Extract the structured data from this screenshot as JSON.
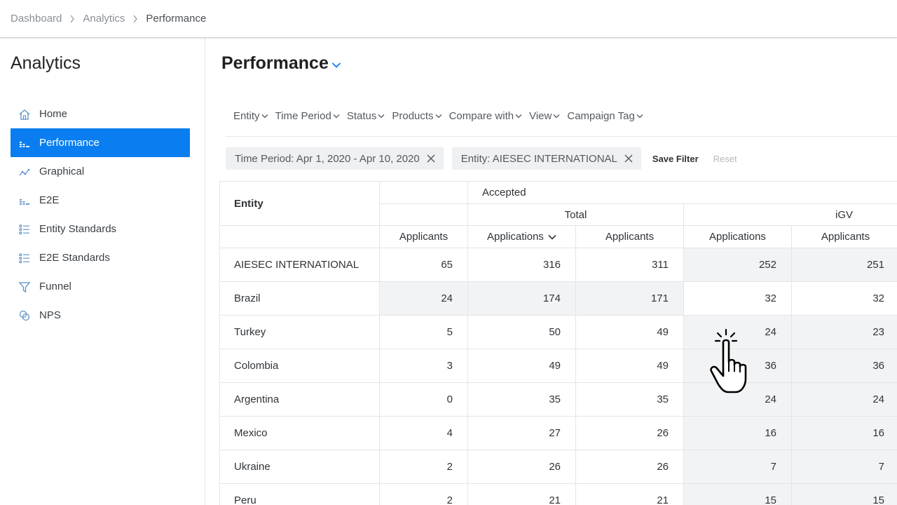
{
  "breadcrumb": [
    "Dashboard",
    "Analytics",
    "Performance"
  ],
  "sidebar": {
    "title": "Analytics",
    "items": [
      {
        "label": "Home",
        "icon": "home-icon",
        "active": false
      },
      {
        "label": "Performance",
        "icon": "bars-icon",
        "active": true
      },
      {
        "label": "Graphical",
        "icon": "line-chart-icon",
        "active": false
      },
      {
        "label": "E2E",
        "icon": "bars-icon",
        "active": false
      },
      {
        "label": "Entity Standards",
        "icon": "list-icon",
        "active": false
      },
      {
        "label": "E2E Standards",
        "icon": "list-icon",
        "active": false
      },
      {
        "label": "Funnel",
        "icon": "funnel-icon",
        "active": false
      },
      {
        "label": "NPS",
        "icon": "nps-icon",
        "active": false
      }
    ]
  },
  "main": {
    "title": "Performance",
    "filters": [
      "Entity",
      "Time Period",
      "Status",
      "Products",
      "Compare with",
      "View",
      "Campaign Tag"
    ],
    "chips": [
      "Time Period: Apr 1, 2020 - Apr 10, 2020",
      "Entity: AIESEC INTERNATIONAL"
    ],
    "save_filter": "Save Filter",
    "reset": "Reset"
  },
  "table": {
    "entity_header": "Entity",
    "group_header": "Accepted",
    "subgroups": [
      "Total",
      "iGV"
    ],
    "columns": [
      "Applicants",
      "Applications",
      "Applicants",
      "Applications",
      "Applicants"
    ],
    "rows": [
      {
        "entity": "AIESEC INTERNATIONAL",
        "values": [
          "65",
          "316",
          "311",
          "252",
          "251"
        ]
      },
      {
        "entity": "Brazil",
        "values": [
          "24",
          "174",
          "171",
          "32",
          "32"
        ]
      },
      {
        "entity": "Turkey",
        "values": [
          "5",
          "50",
          "49",
          "24",
          "23"
        ]
      },
      {
        "entity": "Colombia",
        "values": [
          "3",
          "49",
          "49",
          "36",
          "36"
        ]
      },
      {
        "entity": "Argentina",
        "values": [
          "0",
          "35",
          "35",
          "24",
          "24"
        ]
      },
      {
        "entity": "Mexico",
        "values": [
          "4",
          "27",
          "26",
          "16",
          "16"
        ]
      },
      {
        "entity": "Ukraine",
        "values": [
          "2",
          "26",
          "26",
          "7",
          "7"
        ]
      },
      {
        "entity": "Peru",
        "values": [
          "2",
          "21",
          "21",
          "15",
          "15"
        ]
      }
    ]
  },
  "colors": {
    "accent": "#0a7ef0",
    "row_shade": "#f1f3f5"
  }
}
